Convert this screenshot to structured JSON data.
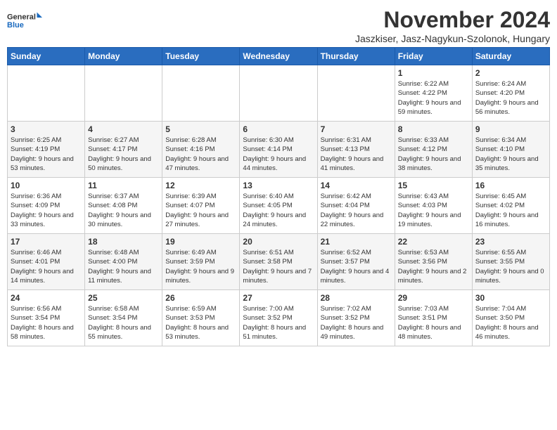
{
  "logo": {
    "line1": "General",
    "line2": "Blue"
  },
  "title": "November 2024",
  "subtitle": "Jaszkiser, Jasz-Nagykun-Szolonok, Hungary",
  "days_of_week": [
    "Sunday",
    "Monday",
    "Tuesday",
    "Wednesday",
    "Thursday",
    "Friday",
    "Saturday"
  ],
  "weeks": [
    [
      {
        "day": "",
        "info": ""
      },
      {
        "day": "",
        "info": ""
      },
      {
        "day": "",
        "info": ""
      },
      {
        "day": "",
        "info": ""
      },
      {
        "day": "",
        "info": ""
      },
      {
        "day": "1",
        "info": "Sunrise: 6:22 AM\nSunset: 4:22 PM\nDaylight: 9 hours and 59 minutes."
      },
      {
        "day": "2",
        "info": "Sunrise: 6:24 AM\nSunset: 4:20 PM\nDaylight: 9 hours and 56 minutes."
      }
    ],
    [
      {
        "day": "3",
        "info": "Sunrise: 6:25 AM\nSunset: 4:19 PM\nDaylight: 9 hours and 53 minutes."
      },
      {
        "day": "4",
        "info": "Sunrise: 6:27 AM\nSunset: 4:17 PM\nDaylight: 9 hours and 50 minutes."
      },
      {
        "day": "5",
        "info": "Sunrise: 6:28 AM\nSunset: 4:16 PM\nDaylight: 9 hours and 47 minutes."
      },
      {
        "day": "6",
        "info": "Sunrise: 6:30 AM\nSunset: 4:14 PM\nDaylight: 9 hours and 44 minutes."
      },
      {
        "day": "7",
        "info": "Sunrise: 6:31 AM\nSunset: 4:13 PM\nDaylight: 9 hours and 41 minutes."
      },
      {
        "day": "8",
        "info": "Sunrise: 6:33 AM\nSunset: 4:12 PM\nDaylight: 9 hours and 38 minutes."
      },
      {
        "day": "9",
        "info": "Sunrise: 6:34 AM\nSunset: 4:10 PM\nDaylight: 9 hours and 35 minutes."
      }
    ],
    [
      {
        "day": "10",
        "info": "Sunrise: 6:36 AM\nSunset: 4:09 PM\nDaylight: 9 hours and 33 minutes."
      },
      {
        "day": "11",
        "info": "Sunrise: 6:37 AM\nSunset: 4:08 PM\nDaylight: 9 hours and 30 minutes."
      },
      {
        "day": "12",
        "info": "Sunrise: 6:39 AM\nSunset: 4:07 PM\nDaylight: 9 hours and 27 minutes."
      },
      {
        "day": "13",
        "info": "Sunrise: 6:40 AM\nSunset: 4:05 PM\nDaylight: 9 hours and 24 minutes."
      },
      {
        "day": "14",
        "info": "Sunrise: 6:42 AM\nSunset: 4:04 PM\nDaylight: 9 hours and 22 minutes."
      },
      {
        "day": "15",
        "info": "Sunrise: 6:43 AM\nSunset: 4:03 PM\nDaylight: 9 hours and 19 minutes."
      },
      {
        "day": "16",
        "info": "Sunrise: 6:45 AM\nSunset: 4:02 PM\nDaylight: 9 hours and 16 minutes."
      }
    ],
    [
      {
        "day": "17",
        "info": "Sunrise: 6:46 AM\nSunset: 4:01 PM\nDaylight: 9 hours and 14 minutes."
      },
      {
        "day": "18",
        "info": "Sunrise: 6:48 AM\nSunset: 4:00 PM\nDaylight: 9 hours and 11 minutes."
      },
      {
        "day": "19",
        "info": "Sunrise: 6:49 AM\nSunset: 3:59 PM\nDaylight: 9 hours and 9 minutes."
      },
      {
        "day": "20",
        "info": "Sunrise: 6:51 AM\nSunset: 3:58 PM\nDaylight: 9 hours and 7 minutes."
      },
      {
        "day": "21",
        "info": "Sunrise: 6:52 AM\nSunset: 3:57 PM\nDaylight: 9 hours and 4 minutes."
      },
      {
        "day": "22",
        "info": "Sunrise: 6:53 AM\nSunset: 3:56 PM\nDaylight: 9 hours and 2 minutes."
      },
      {
        "day": "23",
        "info": "Sunrise: 6:55 AM\nSunset: 3:55 PM\nDaylight: 9 hours and 0 minutes."
      }
    ],
    [
      {
        "day": "24",
        "info": "Sunrise: 6:56 AM\nSunset: 3:54 PM\nDaylight: 8 hours and 58 minutes."
      },
      {
        "day": "25",
        "info": "Sunrise: 6:58 AM\nSunset: 3:54 PM\nDaylight: 8 hours and 55 minutes."
      },
      {
        "day": "26",
        "info": "Sunrise: 6:59 AM\nSunset: 3:53 PM\nDaylight: 8 hours and 53 minutes."
      },
      {
        "day": "27",
        "info": "Sunrise: 7:00 AM\nSunset: 3:52 PM\nDaylight: 8 hours and 51 minutes."
      },
      {
        "day": "28",
        "info": "Sunrise: 7:02 AM\nSunset: 3:52 PM\nDaylight: 8 hours and 49 minutes."
      },
      {
        "day": "29",
        "info": "Sunrise: 7:03 AM\nSunset: 3:51 PM\nDaylight: 8 hours and 48 minutes."
      },
      {
        "day": "30",
        "info": "Sunrise: 7:04 AM\nSunset: 3:50 PM\nDaylight: 8 hours and 46 minutes."
      }
    ]
  ]
}
